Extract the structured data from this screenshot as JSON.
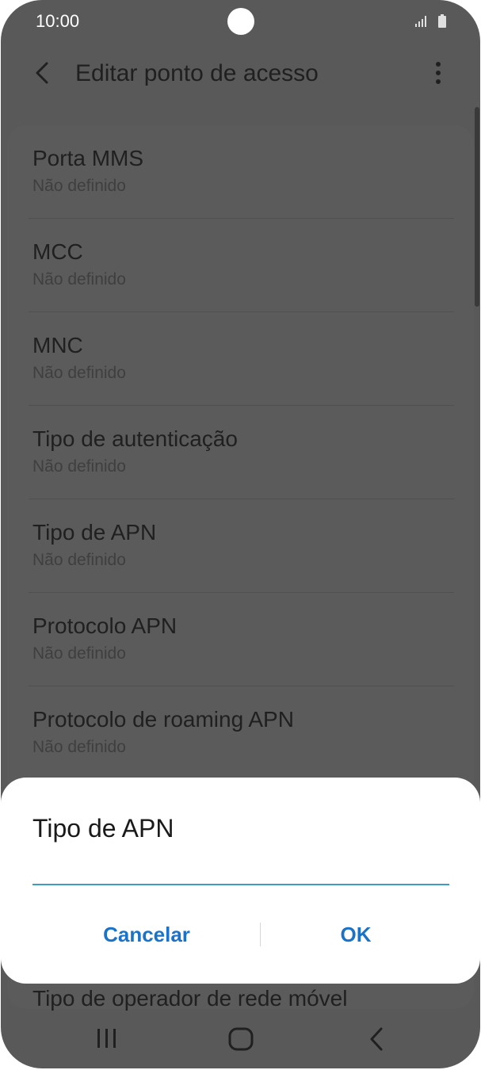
{
  "status_bar": {
    "time": "10:00"
  },
  "app_bar": {
    "title": "Editar ponto de acesso"
  },
  "settings": [
    {
      "label": "Porta MMS",
      "value": "Não definido"
    },
    {
      "label": "MCC",
      "value": "Não definido"
    },
    {
      "label": "MNC",
      "value": "Não definido"
    },
    {
      "label": "Tipo de autenticação",
      "value": "Não definido"
    },
    {
      "label": "Tipo de APN",
      "value": "Não definido"
    },
    {
      "label": "Protocolo APN",
      "value": "Não definido"
    },
    {
      "label": "Protocolo de roaming APN",
      "value": "Não definido"
    }
  ],
  "peek_item": {
    "label": "Tipo de operador de rede móvel"
  },
  "dialog": {
    "title": "Tipo de APN",
    "input_value": "",
    "cancel_label": "Cancelar",
    "ok_label": "OK"
  },
  "colors": {
    "accent": "#1a73c9",
    "input_underline": "#3e9cbf",
    "scrim": "#595959"
  }
}
